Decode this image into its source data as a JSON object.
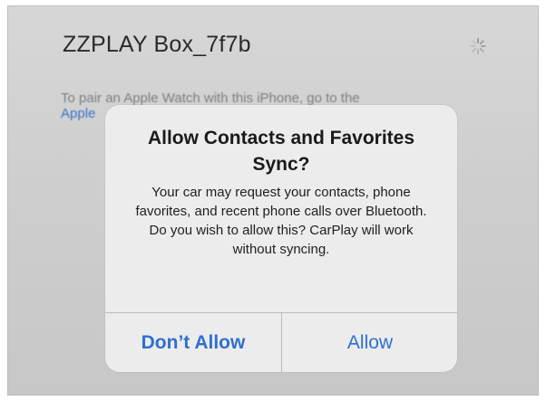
{
  "device": {
    "name": "ZZPLAY Box_7f7b"
  },
  "hint": {
    "text": "To pair an Apple Watch with this iPhone, go to the",
    "link": "Apple"
  },
  "alert": {
    "title": "Allow Contacts and Favorites Sync?",
    "message": "Your car may request your contacts, phone favorites, and recent phone calls over Bluetooth. Do you wish to allow this? CarPlay will work without syncing.",
    "buttons": {
      "dont_allow": "Don’t Allow",
      "allow": "Allow"
    }
  },
  "colors": {
    "accent": "#2f6fd0",
    "link": "#3c73c6"
  },
  "icons": {
    "spinner": "activity-spinner-icon"
  }
}
